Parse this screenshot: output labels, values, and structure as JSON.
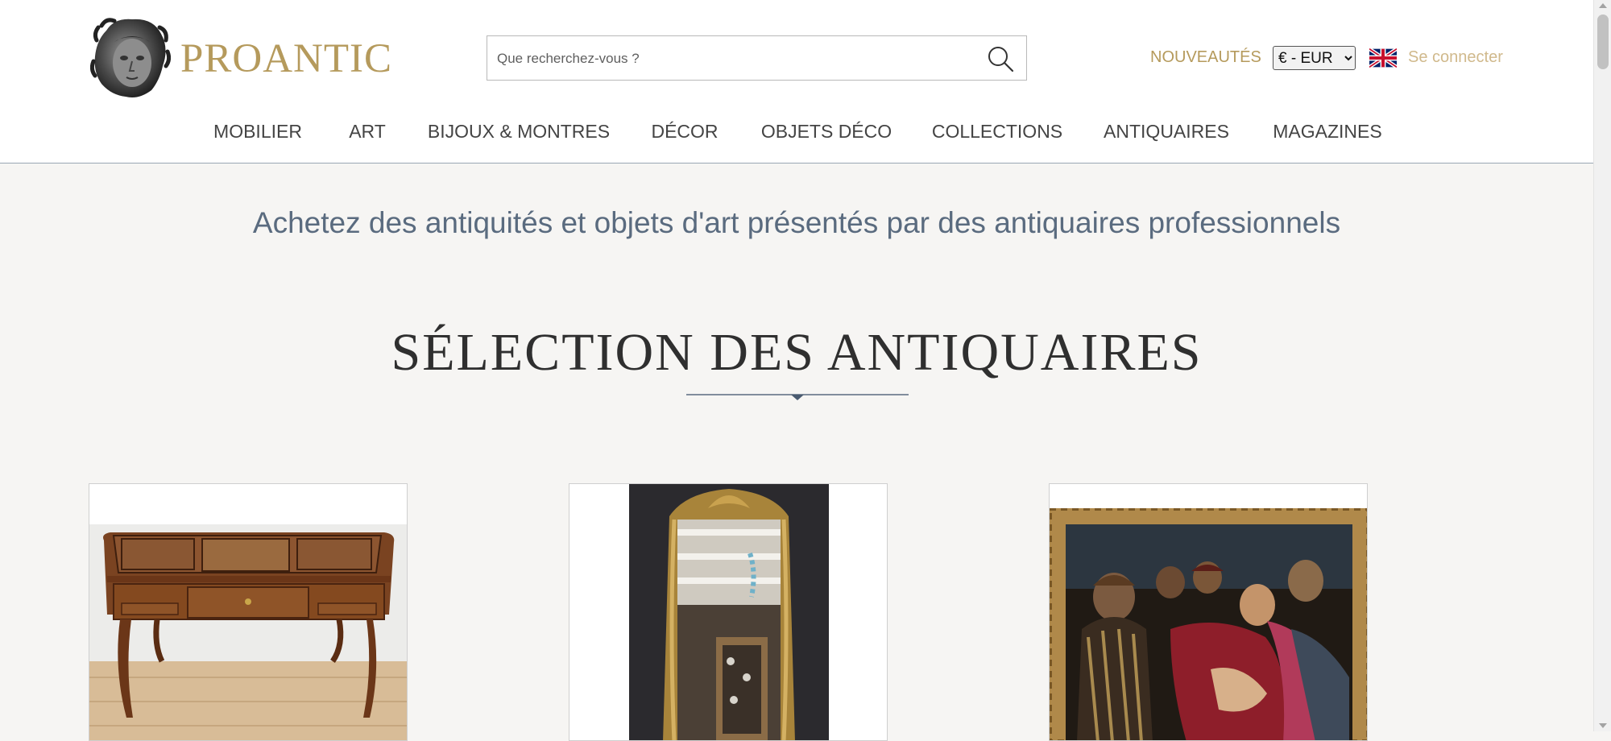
{
  "header": {
    "brand": "PROANTIC",
    "search": {
      "placeholder": "Que recherchez-vous ?"
    },
    "links": {
      "new": "NOUVEAUTÉS",
      "login": "Se connecter"
    },
    "currency": {
      "selected": "€ - EUR"
    },
    "colors": {
      "gold": "#b59a5c",
      "login": "#d0b98c"
    }
  },
  "nav": {
    "items": [
      "MOBILIER",
      "ART",
      "BIJOUX & MONTRES",
      "DÉCOR",
      "OBJETS DÉCO",
      "COLLECTIONS",
      "ANTIQUAIRES",
      "MAGAZINES"
    ]
  },
  "main": {
    "tagline": "Achetez des antiquités et objets d'art présentés par des antiquaires professionnels",
    "section_title": "SÉLECTION DES ANTIQUAIRES"
  },
  "icons": {
    "logo": "statue-head-logo",
    "search": "search-icon",
    "flag": "uk-flag-icon"
  }
}
